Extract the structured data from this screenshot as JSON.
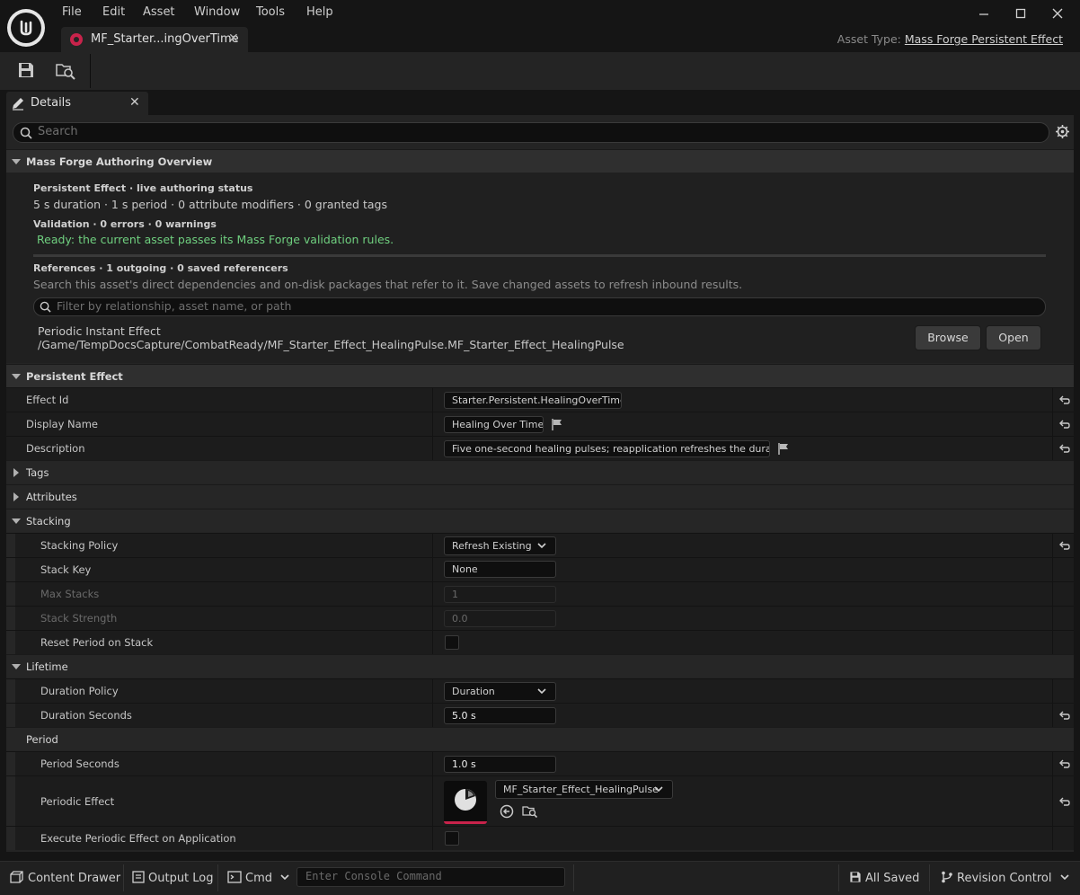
{
  "window": {
    "menu": [
      "File",
      "Edit",
      "Asset",
      "Window",
      "Tools",
      "Help"
    ],
    "tab_title": "MF_Starter...ingOverTime",
    "asset_type_label": "Asset Type:",
    "asset_type_value": "Mass Forge Persistent Effect"
  },
  "details": {
    "tab_label": "Details",
    "search_placeholder": "Search"
  },
  "overview": {
    "header": "Mass Forge Authoring Overview",
    "status_title": "Persistent Effect · live authoring status",
    "status_summary": "5 s duration · 1 s period · 0 attribute modifiers · 0 granted tags",
    "validation_title": "Validation · 0 errors · 0 warnings",
    "validation_message": "Ready: the current asset passes its Mass Forge validation rules.",
    "references_title": "References · 1 outgoing · 0 saved referencers",
    "references_help": "Search this asset's direct dependencies and on-disk packages that refer to it. Save changed assets to refresh inbound results.",
    "filter_placeholder": "Filter by relationship, asset name, or path",
    "reference_type": "Periodic Instant Effect",
    "reference_path": "/Game/TempDocsCapture/CombatReady/MF_Starter_Effect_HealingPulse.MF_Starter_Effect_HealingPulse",
    "browse_label": "Browse",
    "open_label": "Open"
  },
  "persistent_effect": {
    "header": "Persistent Effect",
    "effect_id_label": "Effect Id",
    "effect_id_value": "Starter.Persistent.HealingOverTime",
    "display_name_label": "Display Name",
    "display_name_value": "Healing Over Time",
    "description_label": "Description",
    "description_value": "Five one-second healing pulses; reapplication refreshes the duration.",
    "tags_label": "Tags",
    "attributes_label": "Attributes"
  },
  "stacking": {
    "header": "Stacking",
    "policy_label": "Stacking Policy",
    "policy_value": "Refresh Existing",
    "stack_key_label": "Stack Key",
    "stack_key_value": "None",
    "max_stacks_label": "Max Stacks",
    "max_stacks_value": "1",
    "stack_strength_label": "Stack Strength",
    "stack_strength_value": "0.0",
    "reset_period_label": "Reset Period on Stack"
  },
  "lifetime": {
    "header": "Lifetime",
    "duration_policy_label": "Duration Policy",
    "duration_policy_value": "Duration",
    "duration_seconds_label": "Duration Seconds",
    "duration_seconds_value": "5.0 s"
  },
  "period": {
    "header": "Period",
    "period_seconds_label": "Period Seconds",
    "period_seconds_value": "1.0 s",
    "periodic_effect_label": "Periodic Effect",
    "periodic_effect_value": "MF_Starter_Effect_HealingPulse",
    "execute_on_application_label": "Execute Periodic Effect on Application"
  },
  "statusbar": {
    "content_drawer": "Content Drawer",
    "output_log": "Output Log",
    "cmd": "Cmd",
    "console_placeholder": "Enter Console Command",
    "all_saved": "All Saved",
    "revision_control": "Revision Control"
  }
}
